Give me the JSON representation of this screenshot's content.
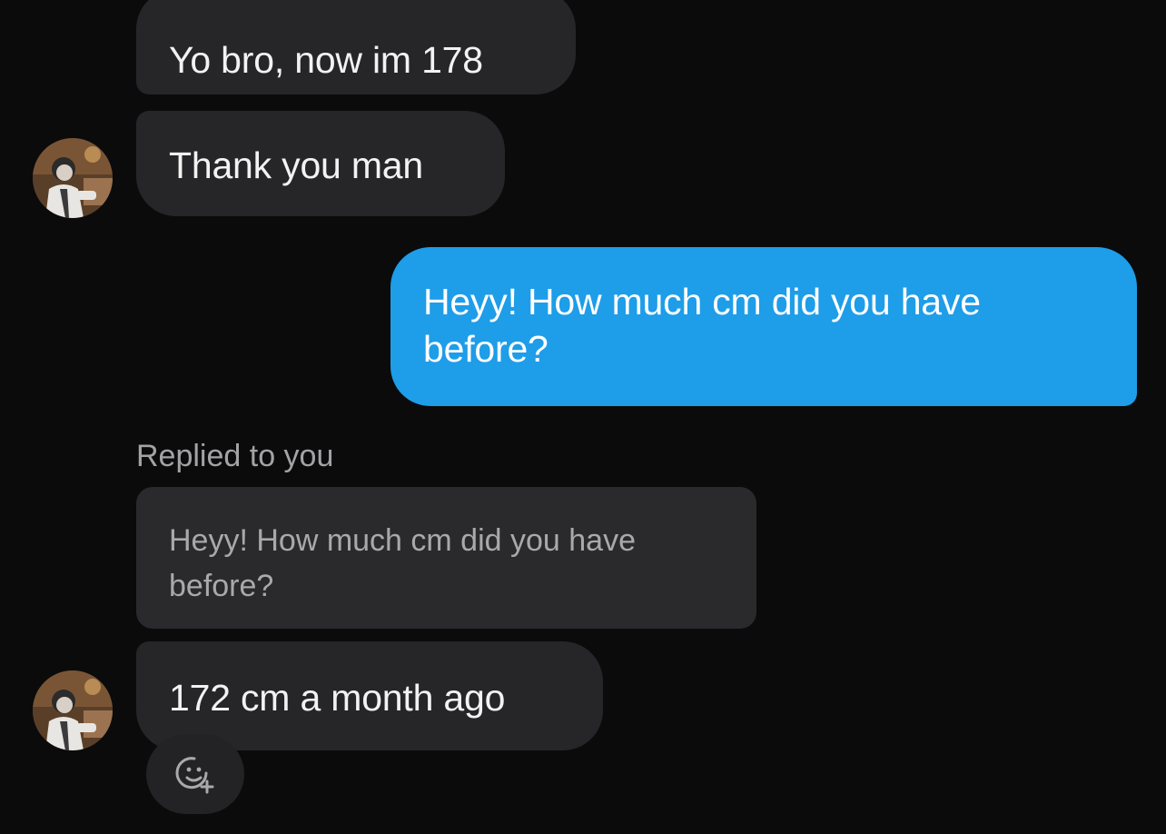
{
  "messages": [
    {
      "id": "m1",
      "direction": "incoming",
      "text": "Yo bro, now im 178",
      "show_avatar": false
    },
    {
      "id": "m2",
      "direction": "incoming",
      "text": "Thank you man",
      "show_avatar": true
    },
    {
      "id": "m3",
      "direction": "outgoing",
      "text": "Heyy! How much cm did you have before?"
    },
    {
      "id": "m4",
      "direction": "incoming",
      "text": "172 cm a month ago",
      "show_avatar": true,
      "reply": {
        "label": "Replied to you",
        "quoted_text": "Heyy! How much cm did you have before?"
      }
    }
  ],
  "reaction_button": {
    "icon": "add-reaction-icon"
  },
  "colors": {
    "background": "#0b0b0c",
    "incoming_bubble": "#262628",
    "outgoing_bubble": "#1e9de9",
    "quoted_bubble": "#2a2a2c",
    "muted_text": "#a3a3a6"
  }
}
